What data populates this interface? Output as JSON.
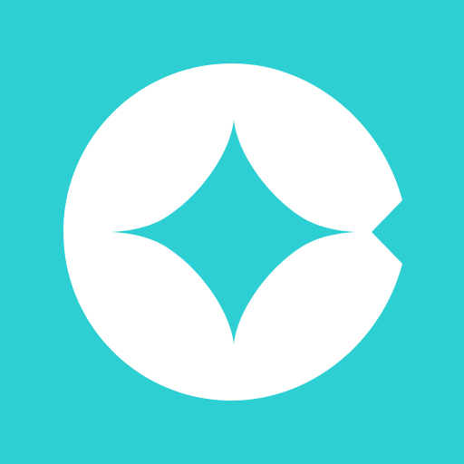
{
  "icon": {
    "name": "app-logo-icon",
    "background_color": "#2ecfd3",
    "foreground_color": "#ffffff",
    "shapes": [
      "white-c-ring",
      "four-point-sparkle"
    ]
  }
}
